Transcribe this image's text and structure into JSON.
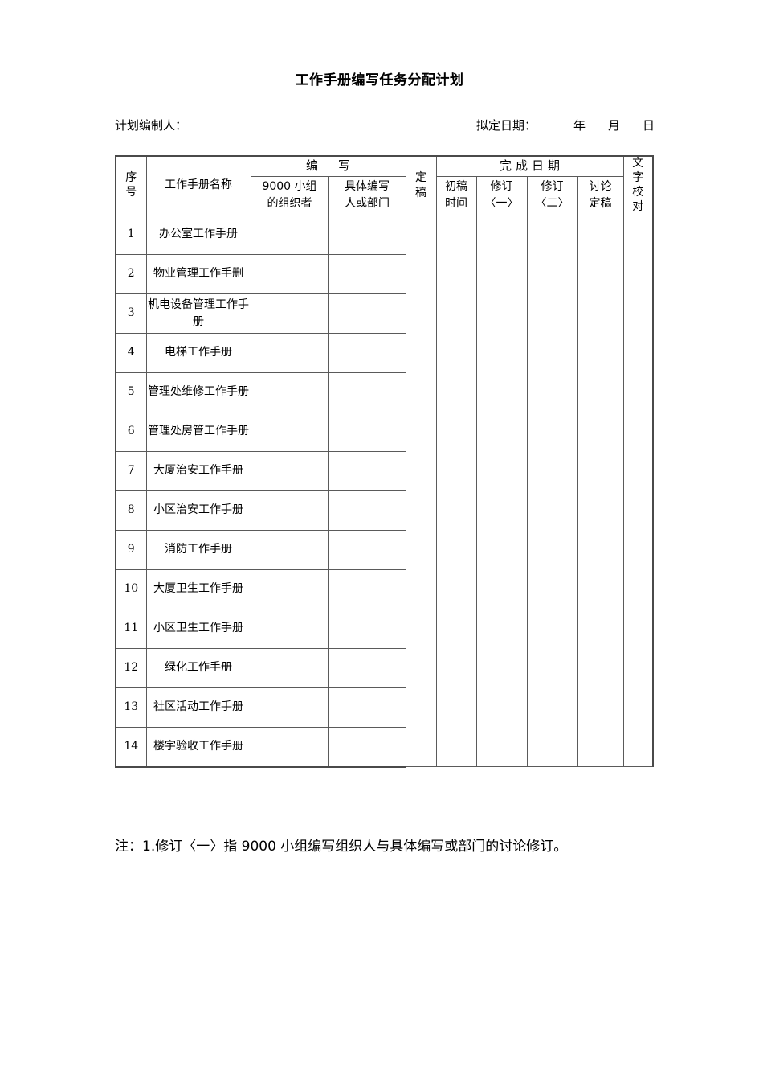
{
  "document": {
    "title": "工作手册编写任务分配计划"
  },
  "meta": {
    "preparer_label": "计划编制人：",
    "date_label": "拟定日期：",
    "year_unit": "年",
    "month_unit": "月",
    "day_unit": "日"
  },
  "table": {
    "header": {
      "index": [
        "序",
        "号"
      ],
      "manual_name": "工作手册名称",
      "writing_group": "编　写",
      "writing_sub_1": {
        "line1": "9000 小组",
        "line2": "的组织者"
      },
      "writing_sub_2": {
        "line1": "具体编写",
        "line2": "人或部门"
      },
      "final_draft": [
        "定",
        "稿"
      ],
      "completion_date_group": "完成日期",
      "completion_sub_1": {
        "line1": "初稿",
        "line2": "时间"
      },
      "completion_sub_2": {
        "line1": "修订",
        "line2": "〈一〉"
      },
      "completion_sub_3": {
        "line1": "修订",
        "line2": "〈二〉"
      },
      "completion_sub_4": {
        "line1": "讨论",
        "line2": "定稿"
      },
      "proofreading": [
        "文",
        "字",
        "校",
        "对"
      ]
    },
    "rows": [
      {
        "no": "1",
        "name": "办公室工作手册"
      },
      {
        "no": "2",
        "name": "物业管理工作手删"
      },
      {
        "no": "3",
        "name": "机电设备管理工作手册"
      },
      {
        "no": "4",
        "name": "电梯工作手册"
      },
      {
        "no": "5",
        "name": "管理处维修工作手册"
      },
      {
        "no": "6",
        "name": "管理处房管工作手册"
      },
      {
        "no": "7",
        "name": "大厦治安工作手册"
      },
      {
        "no": "8",
        "name": "小区治安工作手册"
      },
      {
        "no": "9",
        "name": "消防工作手册"
      },
      {
        "no": "10",
        "name": "大厦卫生工作手册"
      },
      {
        "no": "11",
        "name": "小区卫生工作手册"
      },
      {
        "no": "12",
        "name": "绿化工作手册"
      },
      {
        "no": "13",
        "name": "社区活动工作手册"
      },
      {
        "no": "14",
        "name": "楼宇验收工作手册"
      }
    ]
  },
  "note": {
    "text": "注：1.修订〈一〉指 9000 小组编写组织人与具体编写或部门的讨论修订。"
  }
}
